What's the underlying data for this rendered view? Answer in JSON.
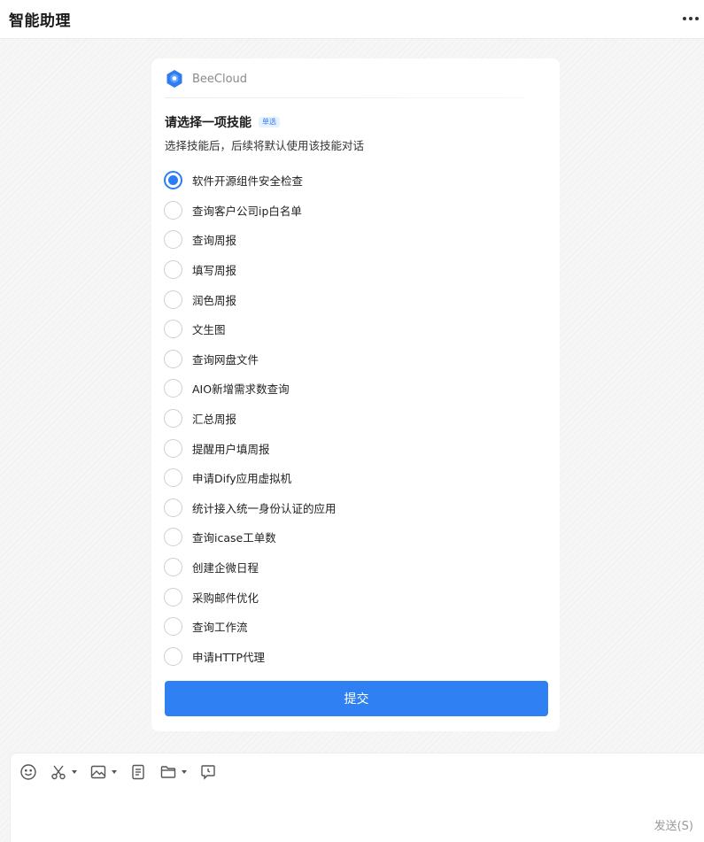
{
  "header": {
    "title": "智能助理"
  },
  "card": {
    "brand": "BeeCloud",
    "question": "请选择一项技能",
    "badge": "单选",
    "subtitle": "选择技能后，后续将默认使用该技能对话",
    "options": [
      {
        "label": "软件开源组件安全检查",
        "selected": true
      },
      {
        "label": "查询客户公司ip白名单",
        "selected": false
      },
      {
        "label": "查询周报",
        "selected": false
      },
      {
        "label": "填写周报",
        "selected": false
      },
      {
        "label": "润色周报",
        "selected": false
      },
      {
        "label": "文生图",
        "selected": false
      },
      {
        "label": "查询网盘文件",
        "selected": false
      },
      {
        "label": "AIO新增需求数查询",
        "selected": false
      },
      {
        "label": "汇总周报",
        "selected": false
      },
      {
        "label": "提醒用户填周报",
        "selected": false
      },
      {
        "label": "申请Dify应用虚拟机",
        "selected": false
      },
      {
        "label": "统计接入统一身份认证的应用",
        "selected": false
      },
      {
        "label": "查询icase工单数",
        "selected": false
      },
      {
        "label": "创建企微日程",
        "selected": false
      },
      {
        "label": "采购邮件优化",
        "selected": false
      },
      {
        "label": "查询工作流",
        "selected": false
      },
      {
        "label": "申请HTTP代理",
        "selected": false
      }
    ],
    "submit_label": "提交"
  },
  "composer": {
    "send_label": "发送(S)",
    "tools": [
      "emoji-icon",
      "scissors-icon",
      "image-icon",
      "document-icon",
      "folder-icon",
      "chat-history-icon"
    ]
  },
  "colors": {
    "accent": "#2f80f2",
    "radio_selected": "#2b7cf6"
  }
}
